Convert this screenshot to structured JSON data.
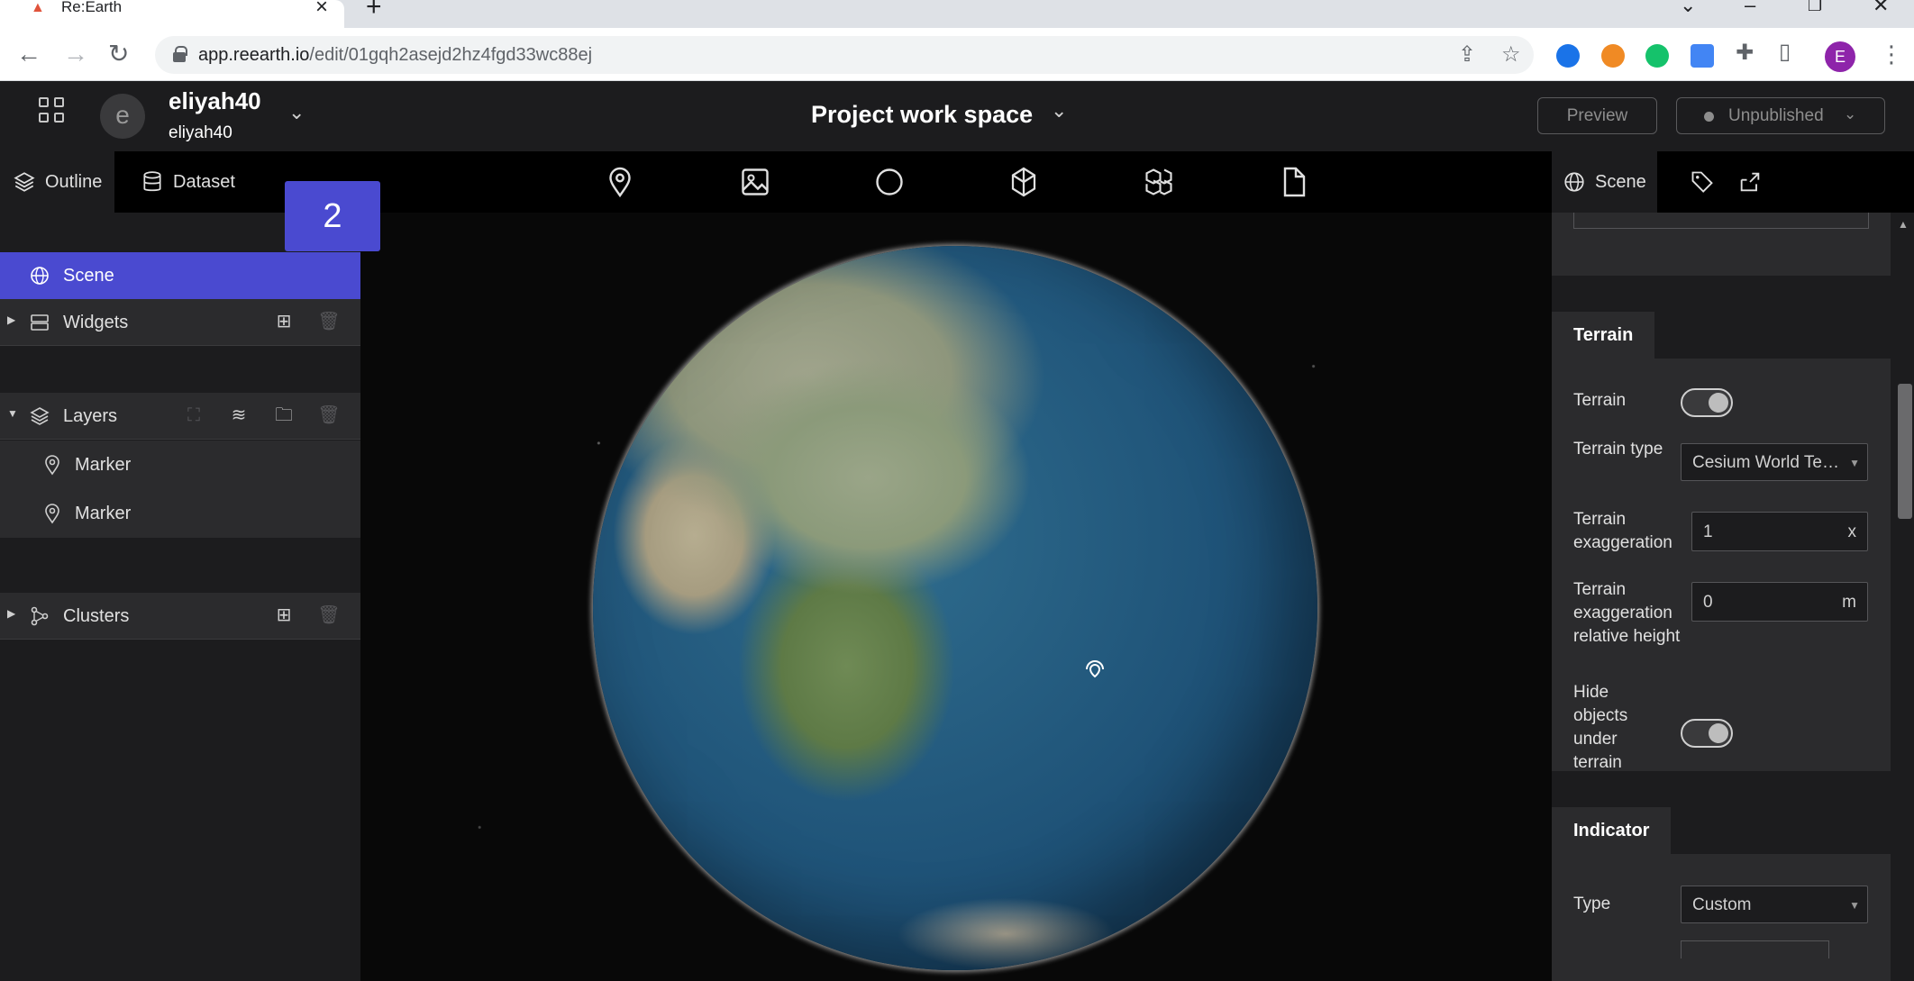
{
  "browser": {
    "tab_title": "Re:Earth",
    "url_host": "app.reearth.io",
    "url_path": "/edit/01gqh2asejd2hz4fgd33wc88ej",
    "profile_initial": "E"
  },
  "header": {
    "avatar_initial": "e",
    "workspace_name": "eliyah40",
    "workspace_sub": "eliyah40",
    "project_title": "Project work space",
    "preview_label": "Preview",
    "publish_status": "Unpublished"
  },
  "left_panel": {
    "tabs": [
      {
        "label": "Outline"
      },
      {
        "label": "Dataset"
      }
    ],
    "step_badge": "2",
    "scene_label": "Scene",
    "widgets_label": "Widgets",
    "layers_label": "Layers",
    "layer_items": [
      {
        "label": "Marker"
      },
      {
        "label": "Marker"
      }
    ],
    "clusters_label": "Clusters"
  },
  "toolbar": {
    "tools": [
      "marker-icon",
      "image-icon",
      "sphere-icon",
      "model-icon",
      "tileset-icon",
      "file-icon"
    ]
  },
  "right_panel": {
    "tab_label": "Scene",
    "terrain_section": {
      "title": "Terrain",
      "terrain_label": "Terrain",
      "terrain_type_label": "Terrain type",
      "terrain_type_value": "Cesium World Terrain",
      "exaggeration_label": "Terrain exaggeration",
      "exaggeration_value": "1",
      "exaggeration_unit": "x",
      "rel_height_label": "Terrain exaggeration relative height",
      "rel_height_value": "0",
      "rel_height_unit": "m",
      "hide_objects_label": "Hide objects under terrain"
    },
    "indicator_section": {
      "title": "Indicator",
      "type_label": "Type",
      "type_value": "Custom"
    }
  },
  "colors": {
    "accent": "#4a4ad0",
    "panel_bg": "#1c1c1e",
    "row_bg": "#2b2b2d"
  }
}
